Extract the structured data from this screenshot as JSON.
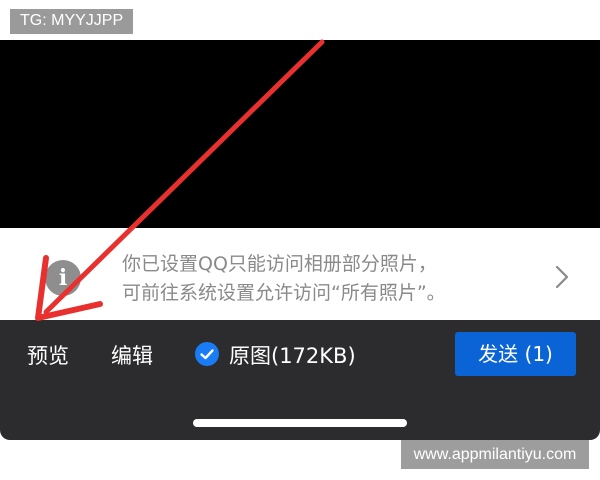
{
  "watermarks": {
    "top": "TG: MYYJJPP",
    "bottom": "www.appmilantiyu.com"
  },
  "notice": {
    "icon": "info-icon",
    "line1": "你已设置QQ只能访问相册部分照片，",
    "line2": "可前往系统设置允许访问“所有照片”。",
    "chevron": "chevron-right-icon"
  },
  "toolbar": {
    "preview_label": "预览",
    "edit_label": "编辑",
    "original_label": "原图(172KB)",
    "original_checked": true,
    "send_label": "发送 (1)"
  },
  "colors": {
    "toolbar_bg": "#2c2c2e",
    "send_button": "#0a64d6",
    "checkbox": "#1a7cf4",
    "annotation_arrow": "#e8312f"
  }
}
